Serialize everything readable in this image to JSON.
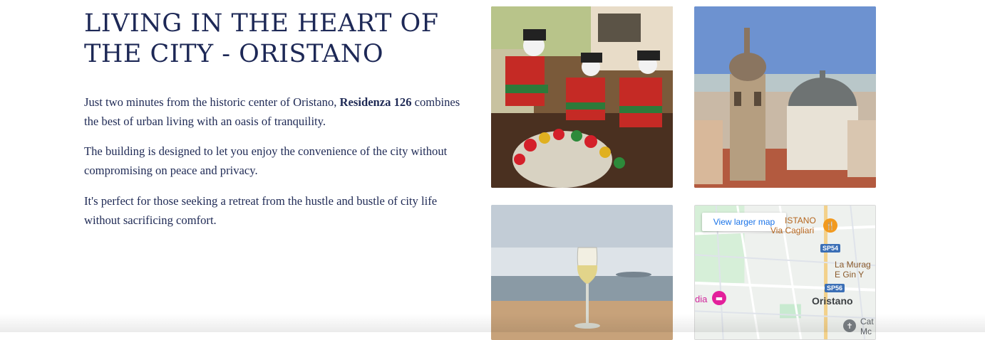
{
  "section": {
    "title": "LIVING IN THE HEART OF THE CITY - ORISTANO",
    "paragraph1": {
      "before": "Just two minutes from the historic center of Oristano, ",
      "strong": "Residenza 126",
      "after": " combines the best of urban living with an oasis of tranquility."
    },
    "paragraph2": "The building is designed to let you enjoy the convenience of the city without compromising on peace and privacy.",
    "paragraph3": "It's perfect for those seeking a retreat from the hustle and bustle of city life without sacrificing comfort."
  },
  "map": {
    "button_label": "View larger map",
    "labels": {
      "oristano_top": "ISTANO",
      "via": "Via Cagliari",
      "muragl": "La Murag",
      "gin": "E Gin Y",
      "dia": "dia",
      "city": "Oristano",
      "cat": "Cat",
      "mc": "Mc"
    },
    "shields": {
      "sp54": "SP54",
      "sp56": "SP56"
    },
    "icons": {
      "food": "restaurant-icon",
      "hotel": "hotel-icon",
      "church": "church-icon"
    }
  },
  "colors": {
    "heading": "#1d2856",
    "body_text": "#1f2a55",
    "map_link": "#1a73e8"
  }
}
